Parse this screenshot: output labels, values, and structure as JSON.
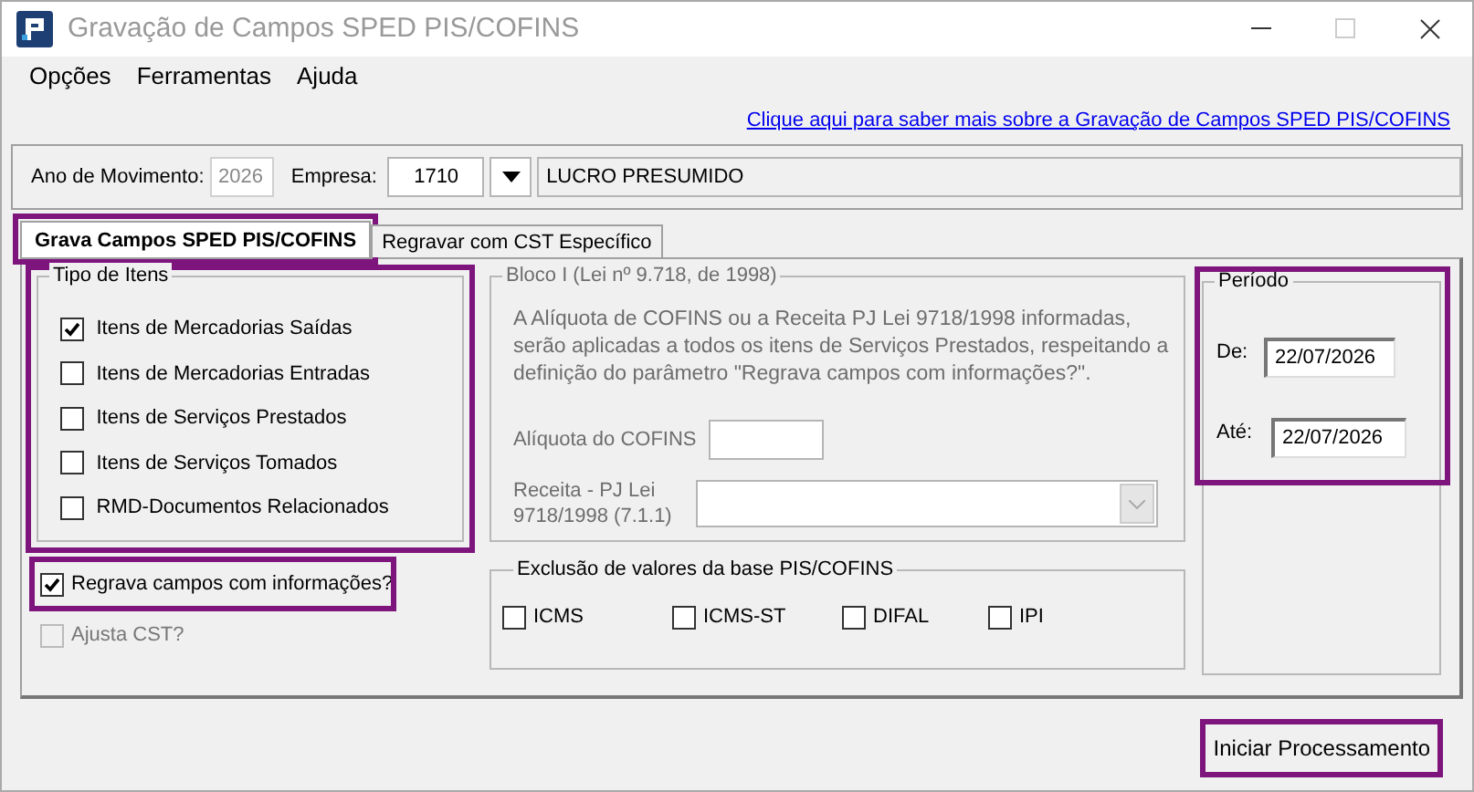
{
  "window": {
    "title": "Gravação de Campos SPED PIS/COFINS"
  },
  "menu": [
    "Opções",
    "Ferramentas",
    "Ajuda"
  ],
  "help_link": "Clique aqui para saber mais sobre a Gravação de Campos SPED PIS/COFINS",
  "header": {
    "year_label": "Ano de Movimento:",
    "year_value": "2026",
    "year_disabled": true,
    "company_label": "Empresa:",
    "company_value": "1710",
    "company_name": "LUCRO PRESUMIDO"
  },
  "tabs": [
    {
      "label": "Grava Campos SPED PIS/COFINS",
      "selected": true,
      "highlighted": true
    },
    {
      "label": "Regravar com CST Específico",
      "selected": false,
      "highlighted": false
    }
  ],
  "item_types": {
    "title": "Tipo de Itens",
    "highlighted": true,
    "items": [
      {
        "label": "Itens de Mercadorias Saídas",
        "checked": true
      },
      {
        "label": "Itens de Mercadorias Entradas",
        "checked": false
      },
      {
        "label": "Itens de Serviços Prestados",
        "checked": false
      },
      {
        "label": "Itens de Serviços Tomados",
        "checked": false
      },
      {
        "label": "RMD-Documentos Relacionados",
        "checked": false
      }
    ]
  },
  "options": [
    {
      "label": "Regrava campos com informações?",
      "checked": true,
      "disabled": false,
      "highlighted": true
    },
    {
      "label": "Ajusta CST?",
      "checked": false,
      "disabled": true,
      "highlighted": false
    }
  ],
  "bloco_i": {
    "title": "Bloco I (Lei nº 9.718, de 1998)",
    "disabled": true,
    "description": "A Alíquota de COFINS ou a Receita PJ Lei 9718/1998 informadas, serão aplicadas a todos os itens de Serviços Prestados, respeitando a definição do parâmetro \"Regrava campos com informações?\".",
    "aliquota_label": "Alíquota do COFINS",
    "receita_label": "Receita - PJ Lei 9718/1998 (7.1.1)"
  },
  "exclusions": {
    "title": "Exclusão de valores da base PIS/COFINS",
    "items": [
      {
        "label": "ICMS",
        "checked": false
      },
      {
        "label": "ICMS-ST",
        "checked": false
      },
      {
        "label": "DIFAL",
        "checked": false
      },
      {
        "label": "IPI",
        "checked": false
      }
    ]
  },
  "period": {
    "title": "Período",
    "highlighted": true,
    "from_label": "De:",
    "from_value": "22/07/2026",
    "to_label": "Até:",
    "to_value": "22/07/2026"
  },
  "start_button": {
    "label": "Iniciar Processamento",
    "highlighted": true
  }
}
